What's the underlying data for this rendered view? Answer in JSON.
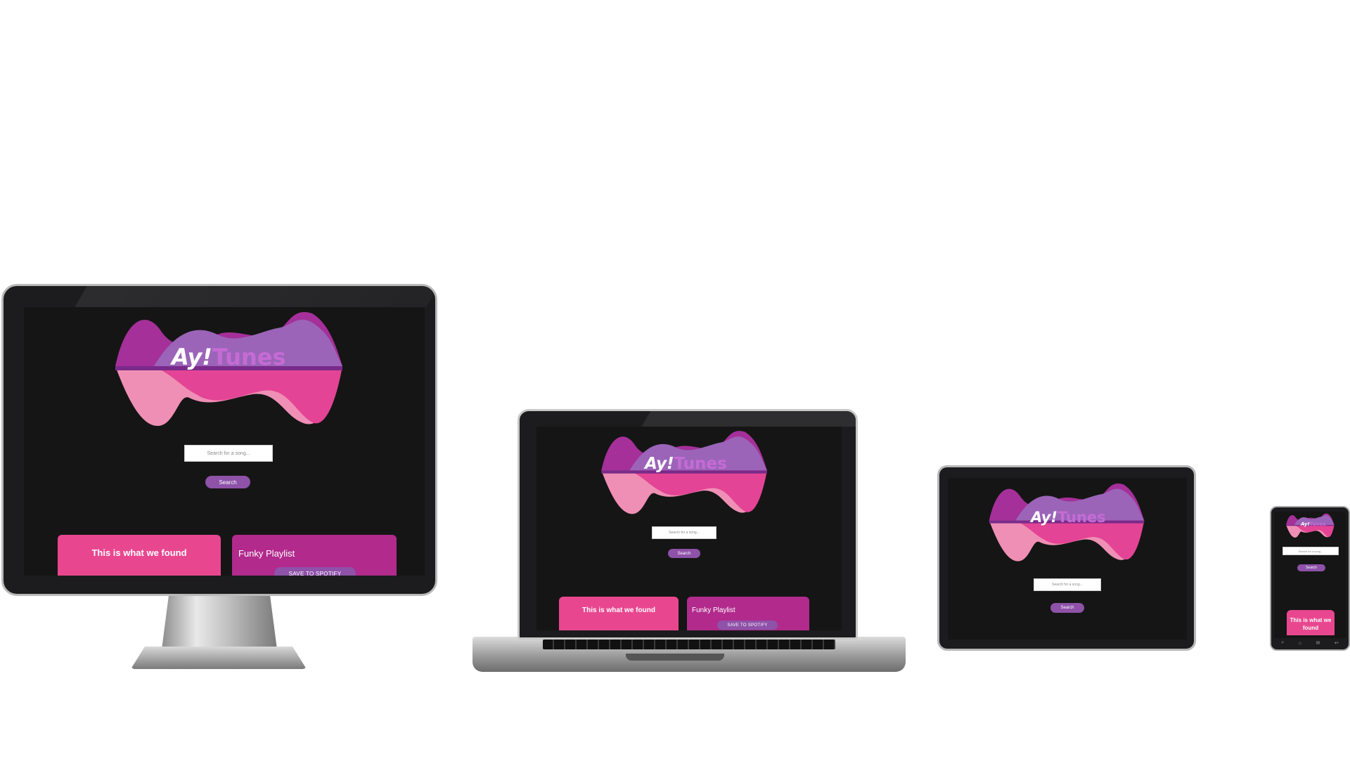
{
  "app": {
    "logo_ay": "Ay!",
    "logo_tunes": "Tunes",
    "search_placeholder": "Search for a song...",
    "search_button": "Search",
    "results_heading": "This is what we found",
    "playlist_name": "Funky Playlist",
    "save_button": "SAVE TO SPOTIFY"
  },
  "colors": {
    "background": "#151515",
    "accent_pink": "#e8478f",
    "accent_magenta": "#b12a8c",
    "accent_purple": "#8e52a9",
    "logo_tunes": "#c66bd6"
  },
  "phone_nav_icons": [
    "search-icon",
    "home-icon",
    "mail-icon",
    "back-icon"
  ]
}
